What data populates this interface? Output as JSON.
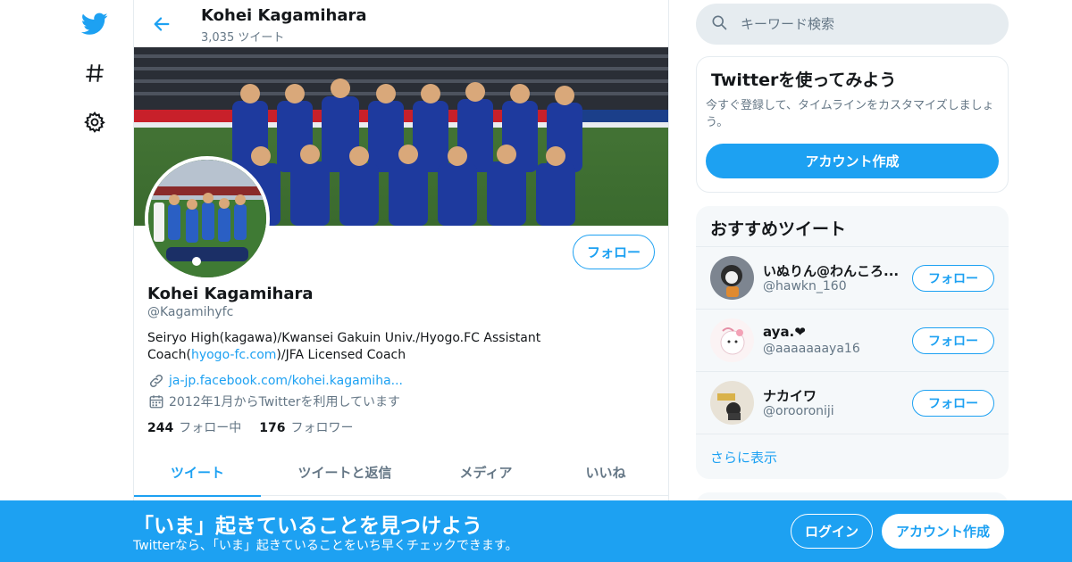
{
  "nav": {
    "icons": [
      "twitter-bird-icon",
      "hashtag-icon",
      "gear-icon"
    ]
  },
  "header": {
    "name": "Kohei Kagamihara",
    "tweet_count": "3,035 ツイート"
  },
  "profile": {
    "name": "Kohei Kagamihara",
    "handle": "@Kagamihyfc",
    "bio_text": "Seiryo High(kagawa)/Kwansei Gakuin Univ./Hyogo.FC Assistant Coach(",
    "bio_link": "hyogo-fc.com",
    "bio_tail": ")/JFA Licensed Coach",
    "website": "ja-jp.facebook.com/kohei.kagamiha...",
    "joined": "2012年1月からTwitterを利用しています",
    "following_count": "244",
    "following_label": "フォロー中",
    "followers_count": "176",
    "followers_label": "フォロワー",
    "follow_button": "フォロー"
  },
  "tabs": [
    {
      "label": "ツイート",
      "active": true
    },
    {
      "label": "ツイートと返信",
      "active": false
    },
    {
      "label": "メディア",
      "active": false
    },
    {
      "label": "いいね",
      "active": false
    }
  ],
  "search": {
    "placeholder": "キーワード検索"
  },
  "try_card": {
    "title": "Twitterを使ってみよう",
    "description": "今すぐ登録して、タイムラインをカスタマイズしましょう。",
    "button": "アカウント作成"
  },
  "recommended": {
    "title": "おすすめツイート",
    "items": [
      {
        "name": "いぬりん@わんころ...",
        "handle": "@hawkn_160",
        "button": "フォロー"
      },
      {
        "name": "aya.❤",
        "handle": "@aaaaaaaya16",
        "button": "フォロー"
      },
      {
        "name": "ナカイワ",
        "handle": "@orooroniji",
        "button": "フォロー"
      }
    ],
    "more": "さらに表示"
  },
  "bottom_bar": {
    "title": "「いま」起きていることを見つけよう",
    "subtitle": "Twitterなら、「いま」起きていることをいち早くチェックできます。",
    "login": "ログイン",
    "signup": "アカウント作成"
  },
  "colors": {
    "accent": "#1da1f2",
    "secondary_text": "#657786",
    "border": "#e6ecf0"
  }
}
